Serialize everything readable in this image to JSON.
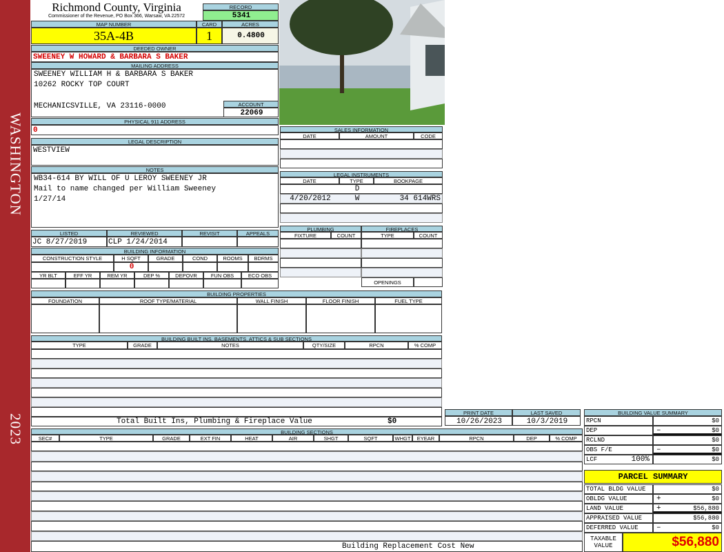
{
  "sidebar": {
    "district": "WASHINGTON",
    "year": "2023"
  },
  "header": {
    "county": "Richmond County, Virginia",
    "subtitle": "Commissioner of the Revenue, PO Box 366, Warsaw, VA 22572",
    "record_label": "RECORD",
    "record": "5341",
    "map_label": "MAP NUMBER",
    "map": "35A-4B",
    "card_label": "CARD",
    "card": "1",
    "acres_label": "ACRES",
    "acres": "0.4800"
  },
  "owner": {
    "label": "DEEDED OWNER",
    "value": "SWEENEY W HOWARD & BARBARA S BAKER"
  },
  "mailing": {
    "label": "MAILING ADDRESS",
    "line1": "SWEENEY WILLIAM H & BARBARA S BAKER",
    "line2": "10262 ROCKY TOP COURT",
    "line3": "MECHANICSVILLE, VA 23116-0000",
    "account_label": "ACCOUNT",
    "account": "22069"
  },
  "physical": {
    "label": "PHYSICAL 911 ADDRESS",
    "value": "0"
  },
  "legal": {
    "label": "LEGAL DESCRIPTION",
    "value": "WESTVIEW"
  },
  "notes": {
    "label": "NOTES",
    "lines": [
      "WB34-614 BY WILL OF U LEROY SWEENEY JR",
      "Mail to name changed per William Sweeney",
      "1/27/14"
    ]
  },
  "review": {
    "headers": [
      "LISTED",
      "REVIEWED",
      "REVISIT",
      "APPEALS"
    ],
    "listed": "JC     8/27/2019",
    "reviewed": "CLP   1/24/2014"
  },
  "building_info": {
    "label": "BUILDING INFORMATION",
    "headers1": [
      "CONSTRUCTION STYLE",
      "H SQFT",
      "GRADE",
      "COND",
      "ROOMS",
      "BDRMS"
    ],
    "hsqft": "0",
    "headers2": [
      "YR BLT",
      "EFF YR",
      "REM YR",
      "DEP %",
      "DEPOVR",
      "FUN OBS",
      "ECO OBS"
    ]
  },
  "sales": {
    "label": "SALES INFORMATION",
    "headers": [
      "DATE",
      "AMOUNT",
      "CODE"
    ]
  },
  "legal_instruments": {
    "label": "LEGAL INSTRUMENTS",
    "headers": [
      "DATE",
      "TYPE",
      "BOOKPAGE"
    ],
    "rows": [
      {
        "date": "",
        "type": "D",
        "bookpage": ""
      },
      {
        "date": "4/20/2012",
        "type": "W",
        "bookpage": "34 614WRS"
      }
    ]
  },
  "plumbing": {
    "label": "PLUMBING",
    "headers": [
      "FIXTURE",
      "COUNT"
    ]
  },
  "fireplaces": {
    "label": "FIREPLACES",
    "headers": [
      "TYPE",
      "COUNT"
    ],
    "openings_label": "OPENINGS"
  },
  "building_properties": {
    "label": "BUILDING PROPERTIES",
    "headers": [
      "FOUNDATION",
      "ROOF TYPE/MATERIAL",
      "WALL FINISH",
      "FLOOR FINISH",
      "FUEL TYPE"
    ]
  },
  "built_ins": {
    "label": "BUILDING BUILT INS, BASEMENTS, ATTICS & SUB SECTIONS",
    "headers": [
      "TYPE",
      "GRADE",
      "NOTES",
      "QTY/SIZE",
      "RPCN",
      "% COMP"
    ],
    "total_label": "Total Built Ins, Plumbing & Fireplace Value",
    "total": "$0"
  },
  "dates": {
    "print_label": "PRINT DATE",
    "print": "10/26/2023",
    "saved_label": "LAST SAVED",
    "saved": "10/3/2019"
  },
  "sections": {
    "label": "BUILDING SECTIONS",
    "headers": [
      "SEC#",
      "TYPE",
      "GRADE",
      "EXT FIN",
      "HEAT",
      "AIR",
      "SHGT",
      "SQFT",
      "WHGT",
      "EYEAR",
      "RPCN",
      "DEP",
      "% COMP"
    ],
    "footer": "Building Replacement Cost New"
  },
  "value_summary": {
    "label": "BUILDING VALUE SUMMARY",
    "rows": [
      {
        "label": "RPCN",
        "op": "",
        "value": "$0"
      },
      {
        "label": "DEP",
        "op": "–",
        "value": "$0"
      },
      {
        "label": "RCLND",
        "op": "",
        "value": "$0"
      },
      {
        "label": "OBS F/E",
        "op": "–",
        "value": "$0"
      },
      {
        "label": "LCF",
        "pct": "100%",
        "op": "",
        "value": "$0"
      }
    ]
  },
  "parcel": {
    "label": "PARCEL SUMMARY",
    "rows": [
      {
        "label": "TOTAL BLDG VALUE",
        "op": "",
        "value": "$0"
      },
      {
        "label": "OBLDG VALUE",
        "op": "+",
        "value": "$0"
      },
      {
        "label": "LAND VALUE",
        "op": "+",
        "value": "$56,880"
      },
      {
        "label": "APPRAISED VALUE",
        "op": "",
        "value": "$56,880"
      },
      {
        "label": "DEFERRED VALUE",
        "op": "–",
        "value": "$0"
      }
    ],
    "taxable_label": "TAXABLE VALUE",
    "taxable": "$56,880"
  },
  "colors": {
    "sidebar": "#a8282c",
    "header_blue": "#a9d3e0",
    "highlight": "#ffff00",
    "record": "#90ee90",
    "taxable": "#e00000"
  }
}
